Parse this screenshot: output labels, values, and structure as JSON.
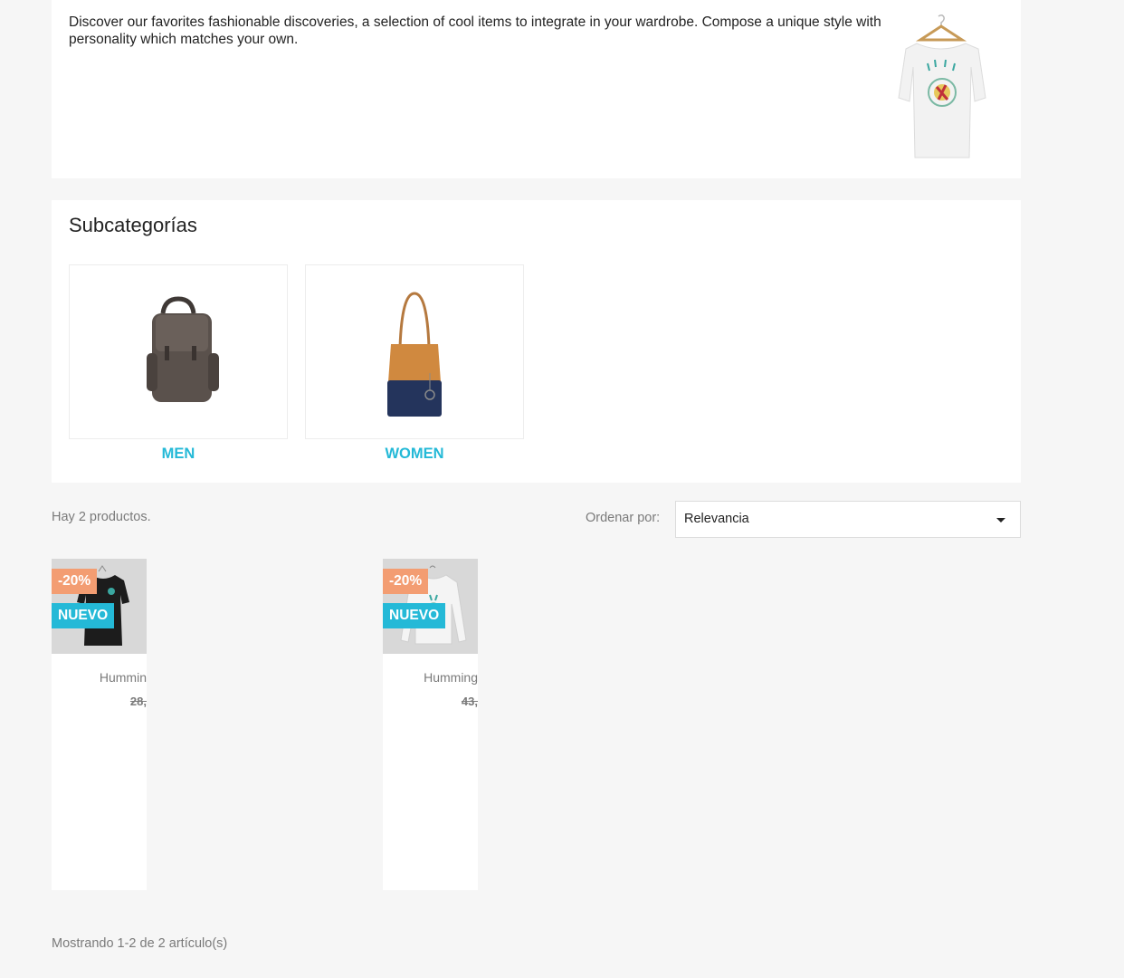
{
  "category": {
    "description": "Discover our favorites fashionable discoveries, a selection of cool items to integrate in your wardrobe. Compose a unique style with personality which matches your own."
  },
  "subcategories": {
    "title": "Subcategorías",
    "items": [
      {
        "name": "MEN",
        "icon": "backpack-image"
      },
      {
        "name": "WOMEN",
        "icon": "handbag-image"
      }
    ]
  },
  "listing": {
    "total": "Hay 2 productos.",
    "sort_label": "Ordenar por:",
    "sort_value": "Relevancia"
  },
  "products": [
    {
      "discount": "-20%",
      "flag": "NUEVO",
      "title": "Hummin",
      "regular_price": "28,",
      "image": "black-tshirt"
    },
    {
      "discount": "-20%",
      "flag": "NUEVO",
      "title": "Humming",
      "regular_price": "43,",
      "image": "white-longsleeve-tshirt"
    }
  ],
  "pagination": {
    "summary": "Mostrando 1-2 de 2 artículo(s)"
  },
  "colors": {
    "accent": "#24b9d7",
    "discount": "#f39d72",
    "background": "#f6f6f6"
  }
}
